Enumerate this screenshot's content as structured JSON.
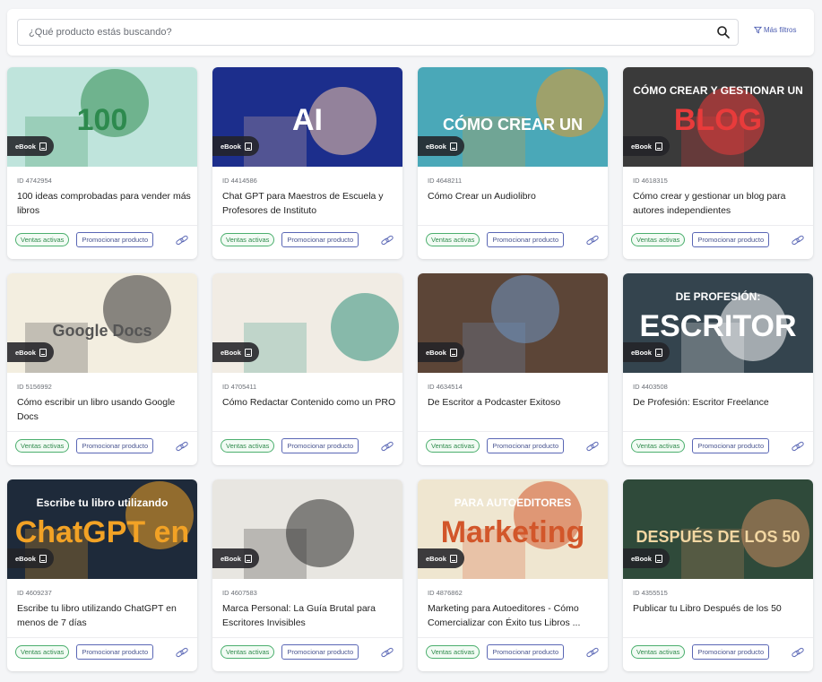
{
  "search": {
    "placeholder": "¿Qué producto estás buscando?"
  },
  "filters_label": "Más filtros",
  "colors": {
    "accent": "#5a67b5",
    "status_green": "#4caf6e"
  },
  "products": [
    {
      "format": "eBook",
      "id": "ID 4742954",
      "title": "100 ideas comprobadas para vender más libros",
      "status": "Ventas activas",
      "action": "Promocionar producto",
      "cover": {
        "bg": "#bfe4dc",
        "fg": "#2d8a4e",
        "text": "100",
        "text_color": "#2d8a4e"
      }
    },
    {
      "format": "eBook",
      "id": "ID 4414586",
      "title": "Chat GPT para Maestros de Escuela y Profesores de Instituto",
      "status": "Ventas activas",
      "action": "Promocionar producto",
      "cover": {
        "bg": "#1c2e8c",
        "fg": "#f5c9a8",
        "text": "AI",
        "text_color": "#ffffff"
      }
    },
    {
      "format": "eBook",
      "id": "ID 4648211",
      "title": "Cómo Crear un Audiolibro",
      "status": "Ventas activas",
      "action": "Promocionar producto",
      "cover": {
        "bg": "#4aa8b8",
        "fg": "#e49b2c",
        "text": "CÓMO CREAR UN",
        "text_color": "#ffffff"
      }
    },
    {
      "format": "eBook",
      "id": "ID 4618315",
      "title": "Cómo crear y gestionar un blog para autores independientes",
      "status": "Ventas activas",
      "action": "Promocionar producto",
      "cover": {
        "bg": "#3a3a3a",
        "fg": "#e83b3b",
        "text": "BLOG",
        "text_color": "#e83b3b",
        "subtext": "CÓMO CREAR Y GESTIONAR UN"
      }
    },
    {
      "format": "eBook",
      "id": "ID 5156992",
      "title": "Cómo escribir un libro usando Google Docs",
      "status": "Ventas activas",
      "action": "Promocionar producto",
      "cover": {
        "bg": "#f3eee0",
        "fg": "#2e2e2e",
        "text": "Google Docs",
        "text_color": "#555555"
      }
    },
    {
      "format": "eBook",
      "id": "ID 4705411",
      "title": "Cómo Redactar Contenido como un PRO",
      "status": "Ventas activas",
      "action": "Promocionar producto",
      "cover": {
        "bg": "#f1ece4",
        "fg": "#2f8f7a",
        "text": "",
        "text_color": "#333333"
      }
    },
    {
      "format": "eBook",
      "id": "ID 4634514",
      "title": "De Escritor a Podcaster Exitoso",
      "status": "Ventas activas",
      "action": "Promocionar producto",
      "cover": {
        "bg": "#5c4537",
        "fg": "#6f96c4",
        "text": "",
        "text_color": "#ffffff"
      }
    },
    {
      "format": "eBook",
      "id": "ID 4403508",
      "title": "De Profesión: Escritor Freelance",
      "status": "Ventas activas",
      "action": "Promocionar producto",
      "cover": {
        "bg": "#34444e",
        "fg": "#ffffff",
        "text": "ESCRITOR",
        "text_color": "#ffffff",
        "subtext": "DE PROFESIÓN:"
      }
    },
    {
      "format": "eBook",
      "id": "ID 4609237",
      "title": "Escribe tu libro utilizando ChatGPT en menos de 7 días",
      "status": "Ventas activas",
      "action": "Promocionar producto",
      "cover": {
        "bg": "#1e2a3a",
        "fg": "#f2a225",
        "text": "ChatGPT en",
        "text_color": "#f2a225",
        "subtext": "Escribe tu libro utilizando"
      }
    },
    {
      "format": "eBook",
      "id": "ID 4607583",
      "title": "Marca Personal: La Guía Brutal para Escritores Invisibles",
      "status": "Ventas activas",
      "action": "Promocionar producto",
      "cover": {
        "bg": "#e8e6e1",
        "fg": "#2a2a2a",
        "text": "",
        "text_color": "#333333"
      }
    },
    {
      "format": "eBook",
      "id": "ID 4876862",
      "title": "Marketing para Autoeditores - Cómo Comercializar con Éxito tus Libros ...",
      "status": "Ventas activas",
      "action": "Promocionar producto",
      "cover": {
        "bg": "#efe6d0",
        "fg": "#d2562a",
        "text": "Marketing",
        "text_color": "#d2562a",
        "subtext": "PARA AUTOEDITORES"
      }
    },
    {
      "format": "eBook",
      "id": "ID 4355515",
      "title": "Publicar tu Libro Después de los 50",
      "status": "Ventas activas",
      "action": "Promocionar producto",
      "cover": {
        "bg": "#2f4a3a",
        "fg": "#c98a5e",
        "text": "DESPUÉS DE LOS 50",
        "text_color": "#f3d7a2"
      }
    }
  ]
}
